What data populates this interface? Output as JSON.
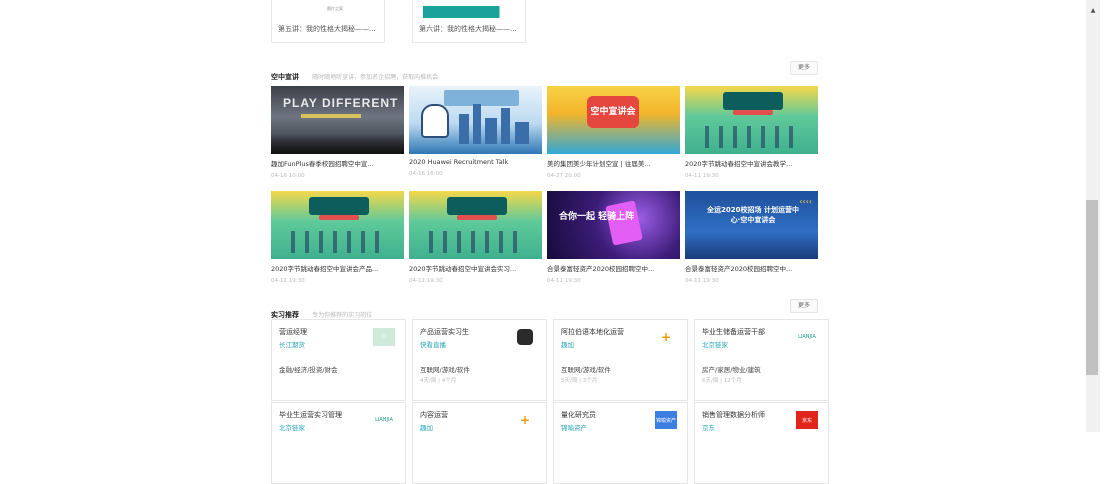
{
  "courses": [
    {
      "tag": "图片之家",
      "title": "第五讲：我的性格大揭秘——..."
    },
    {
      "tag": "",
      "title": "第六讲：我的性格大揭秘——..."
    }
  ],
  "talks_section": {
    "title": "空中宣讲",
    "subtitle": "随时随地听宣讲，参加名企招聘，获取内推机会",
    "more": "更多",
    "items": [
      {
        "name": "趣加FunPlus春季校园招聘空中宣...",
        "time": "04-16 10:00",
        "image_text": "PLAY DIFFERENT"
      },
      {
        "name": "2020 Huawei Recruitment Talk",
        "time": "04-16 16:00",
        "image_text": ""
      },
      {
        "name": "美的集团美少年计划空宣 | 往届美...",
        "time": "04-27 20:00",
        "image_text": "空中宣讲会"
      },
      {
        "name": "2020字节跳动春招空中宣讲会教学...",
        "time": "04-11 19:30",
        "image_text": "看路开学满北"
      },
      {
        "name": "2020字节跳动春招空中宣讲会产品...",
        "time": "04-11 19:30",
        "image_text": "看路开学满北"
      },
      {
        "name": "2020字节跳动春招空中宣讲会实习...",
        "time": "04-11 19:30",
        "image_text": "看路开学满北"
      },
      {
        "name": "合景泰富轻资产2020校园招聘空中...",
        "time": "04-11 19:30",
        "image_text": "合你一起 轻骑上阵"
      },
      {
        "name": "合景泰富轻资产2020校园招聘空中...",
        "time": "04-11 19:30",
        "image_text": "全运2020校招场 计划运营中心·空中宣讲会"
      }
    ]
  },
  "intern_section": {
    "title": "实习推荐",
    "subtitle": "专为你推荐的实习岗位",
    "more": "更多",
    "jobs": [
      {
        "title": "营运经理",
        "company": "长江期货",
        "industry": "金融/经济/投资/财会",
        "meta": "",
        "logo": "ci",
        "logo_text": "CI"
      },
      {
        "title": "产品运营实习生",
        "company": "快看直播",
        "industry": "互联网/游戏/软件",
        "meta": "4天/周 | 4个月",
        "logo": "owl",
        "logo_text": ""
      },
      {
        "title": "阿拉伯语本地化运营",
        "company": "趣加",
        "industry": "互联网/游戏/软件",
        "meta": "5天/周 | 3个月",
        "logo": "plus",
        "logo_text": "+"
      },
      {
        "title": "毕业生储备运营干部",
        "company": "北京链家",
        "industry": "房产/家居/物业/建筑",
        "meta": "6天/周 | 12个月",
        "logo": "txt",
        "logo_text": "LIANJIA"
      },
      {
        "title": "毕业生运营实习管理",
        "company": "北京链家",
        "industry": "",
        "meta": "",
        "logo": "txt",
        "logo_text": "LIANJIA"
      },
      {
        "title": "内容运营",
        "company": "趣加",
        "industry": "",
        "meta": "",
        "logo": "plus",
        "logo_text": "+"
      },
      {
        "title": "量化研究员",
        "company": "锦喻资产",
        "industry": "",
        "meta": "",
        "logo": "blue",
        "logo_text": "锦喻资产"
      },
      {
        "title": "销售管理数据分析师",
        "company": "京东",
        "industry": "",
        "meta": "",
        "logo": "jd",
        "logo_text": "京东"
      }
    ]
  },
  "scrollbar": {
    "up_arrow": "▲"
  }
}
